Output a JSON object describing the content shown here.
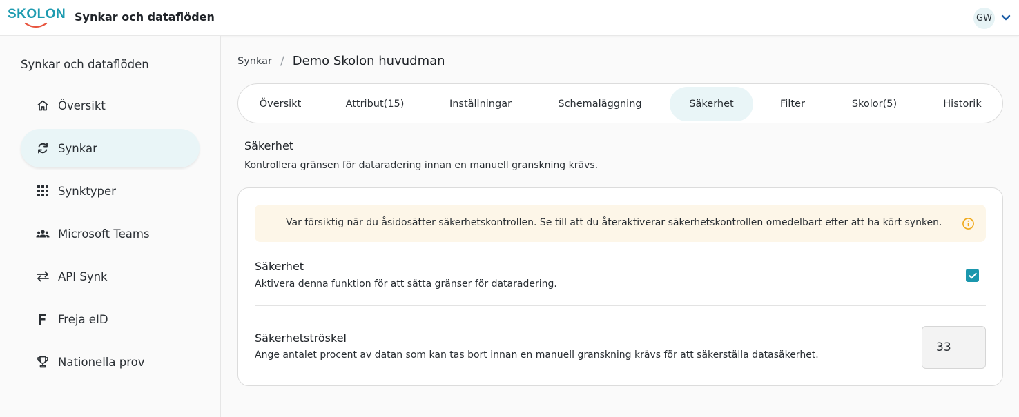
{
  "header": {
    "logo_text": "SKOLON",
    "title": "Synkar och dataflöden",
    "user_initials": "GW",
    "brand_color": "#1e9bb0"
  },
  "sidebar": {
    "heading": "Synkar och dataflöden",
    "items": [
      {
        "label": "Översikt",
        "icon": "home-icon",
        "active": false
      },
      {
        "label": "Synkar",
        "icon": "sync-icon",
        "active": true
      },
      {
        "label": "Synktyper",
        "icon": "grid-icon",
        "active": false
      },
      {
        "label": "Microsoft Teams",
        "icon": "people-icon",
        "active": false
      },
      {
        "label": "API Synk",
        "icon": "swap-arrows-icon",
        "active": false
      },
      {
        "label": "Freja eID",
        "icon": "freja-logo-icon",
        "active": false
      },
      {
        "label": "Nationella prov",
        "icon": "trophy-icon",
        "active": false
      }
    ]
  },
  "breadcrumb": {
    "parent": "Synkar",
    "separator": "/",
    "current": "Demo Skolon huvudman"
  },
  "tabs": [
    {
      "label": "Översikt",
      "active": false
    },
    {
      "label": "Attribut(15)",
      "active": false
    },
    {
      "label": "Inställningar",
      "active": false
    },
    {
      "label": "Schemaläggning",
      "active": false
    },
    {
      "label": "Säkerhet",
      "active": true
    },
    {
      "label": "Filter",
      "active": false
    },
    {
      "label": "Skolor(5)",
      "active": false
    },
    {
      "label": "Historik",
      "active": false
    }
  ],
  "section": {
    "title": "Säkerhet",
    "description": "Kontrollera gränsen för dataradering innan en manuell granskning krävs."
  },
  "card": {
    "alert_text": "Var försiktig när du åsidosätter säkerhetskontrollen. Se till att du återaktiverar säkerhetskontrollen omedelbart efter att ha kört synken.",
    "alert_color": "#f0a818",
    "security": {
      "title": "Säkerhet",
      "description": "Aktivera denna funktion för att sätta gränser för dataradering.",
      "checked": true
    },
    "threshold": {
      "title": "Säkerhetströskel",
      "description": "Ange antalet procent av datan som kan tas bort innan en manuell granskning krävs för att säkerställa datasäkerhet.",
      "value": "33"
    }
  }
}
